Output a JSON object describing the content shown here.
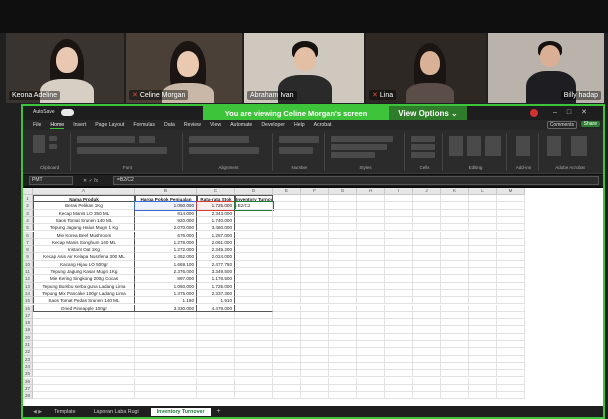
{
  "participants": [
    {
      "name": "Keona Adeline",
      "muted": false
    },
    {
      "name": "Celine Morgan",
      "muted": true
    },
    {
      "name": "Abraham Ivan",
      "muted": false
    },
    {
      "name": "Lina",
      "muted": true
    },
    {
      "name": "Billy hadap",
      "muted": false
    }
  ],
  "share_banner": {
    "message": "You are viewing  Celine Morgan's screen",
    "view_options": "View Options ⌄"
  },
  "excel": {
    "autosave": "AutoSave",
    "menu": [
      "File",
      "Home",
      "Insert",
      "Page Layout",
      "Formulas",
      "Data",
      "Review",
      "View",
      "Automate",
      "Developer",
      "Help",
      "Acrobat"
    ],
    "comments": "Comments",
    "share": "Share",
    "ribbon_groups": [
      "Clipboard",
      "Font",
      "Alignment",
      "Number",
      "Styles",
      "Cells",
      "Editing",
      "Add-ins",
      "Adobe Acrobat"
    ],
    "namebox": "PMT",
    "fx": "fx",
    "formula": "=B2/C2",
    "columns": [
      "A",
      "B",
      "C",
      "D",
      "E",
      "F",
      "G",
      "H",
      "I",
      "J",
      "K",
      "L",
      "M"
    ],
    "headers": [
      "Nama Produk",
      "Harga Pokok Penjualan",
      "Rata-rata Stok",
      "Inventory Turnover"
    ],
    "rows": [
      [
        "Beras Pelikan 1Kg",
        "1.050.000",
        "1.725.000",
        "=B2/C2"
      ],
      [
        "Kecap Manis LO 350 ML",
        "814.000",
        "2.343.000",
        ""
      ],
      [
        "Saos Tomat Srunen 140 ML",
        "920.000",
        "1.740.000",
        ""
      ],
      [
        "Tepung Jagung Halus Mugn 1 Kg",
        "2.070.000",
        "3.460.000",
        ""
      ],
      [
        "Mie Korea Beef Mushroom",
        "676.000",
        "1.287.000",
        ""
      ],
      [
        "Kecap Manis Songhum 140 ML",
        "1.278.000",
        "2.061.000",
        ""
      ],
      [
        "Instant Oat 1Kg",
        "1.272.000",
        "2.345.200",
        ""
      ],
      [
        "Kecap Asin Air Kelapa Nusrfena 300 ML",
        "1.452.000",
        "2.024.000",
        ""
      ],
      [
        "Kacang Hijau LO 500gr",
        "1.669.100",
        "2.477.750",
        ""
      ],
      [
        "Tepung Jagung Kasar Mugn 1Kg",
        "2.376.000",
        "3.349.500",
        ""
      ],
      [
        "Mie Kering Singkong 200g Cocas",
        "897.000",
        "1.176.500",
        ""
      ],
      [
        "Tepung Bumbu serba guna Ladang Lima",
        "1.050.000",
        "1.725.000",
        ""
      ],
      [
        "Tepung Mix Pancake 100gr Ladang Lima",
        "1.375.000",
        "2.337.300",
        ""
      ],
      [
        "Saos Tomat Pedas Srunen 140 ML",
        "1.180",
        "1.910",
        ""
      ],
      [
        "Dried Pineapple 100gr",
        "3.330.000",
        "4.479.000",
        ""
      ]
    ],
    "sheet_tabs": [
      "Template",
      "Laporan Laba Rugi",
      "Inventory Turnover"
    ],
    "active_tab": "Inventory Turnover"
  }
}
